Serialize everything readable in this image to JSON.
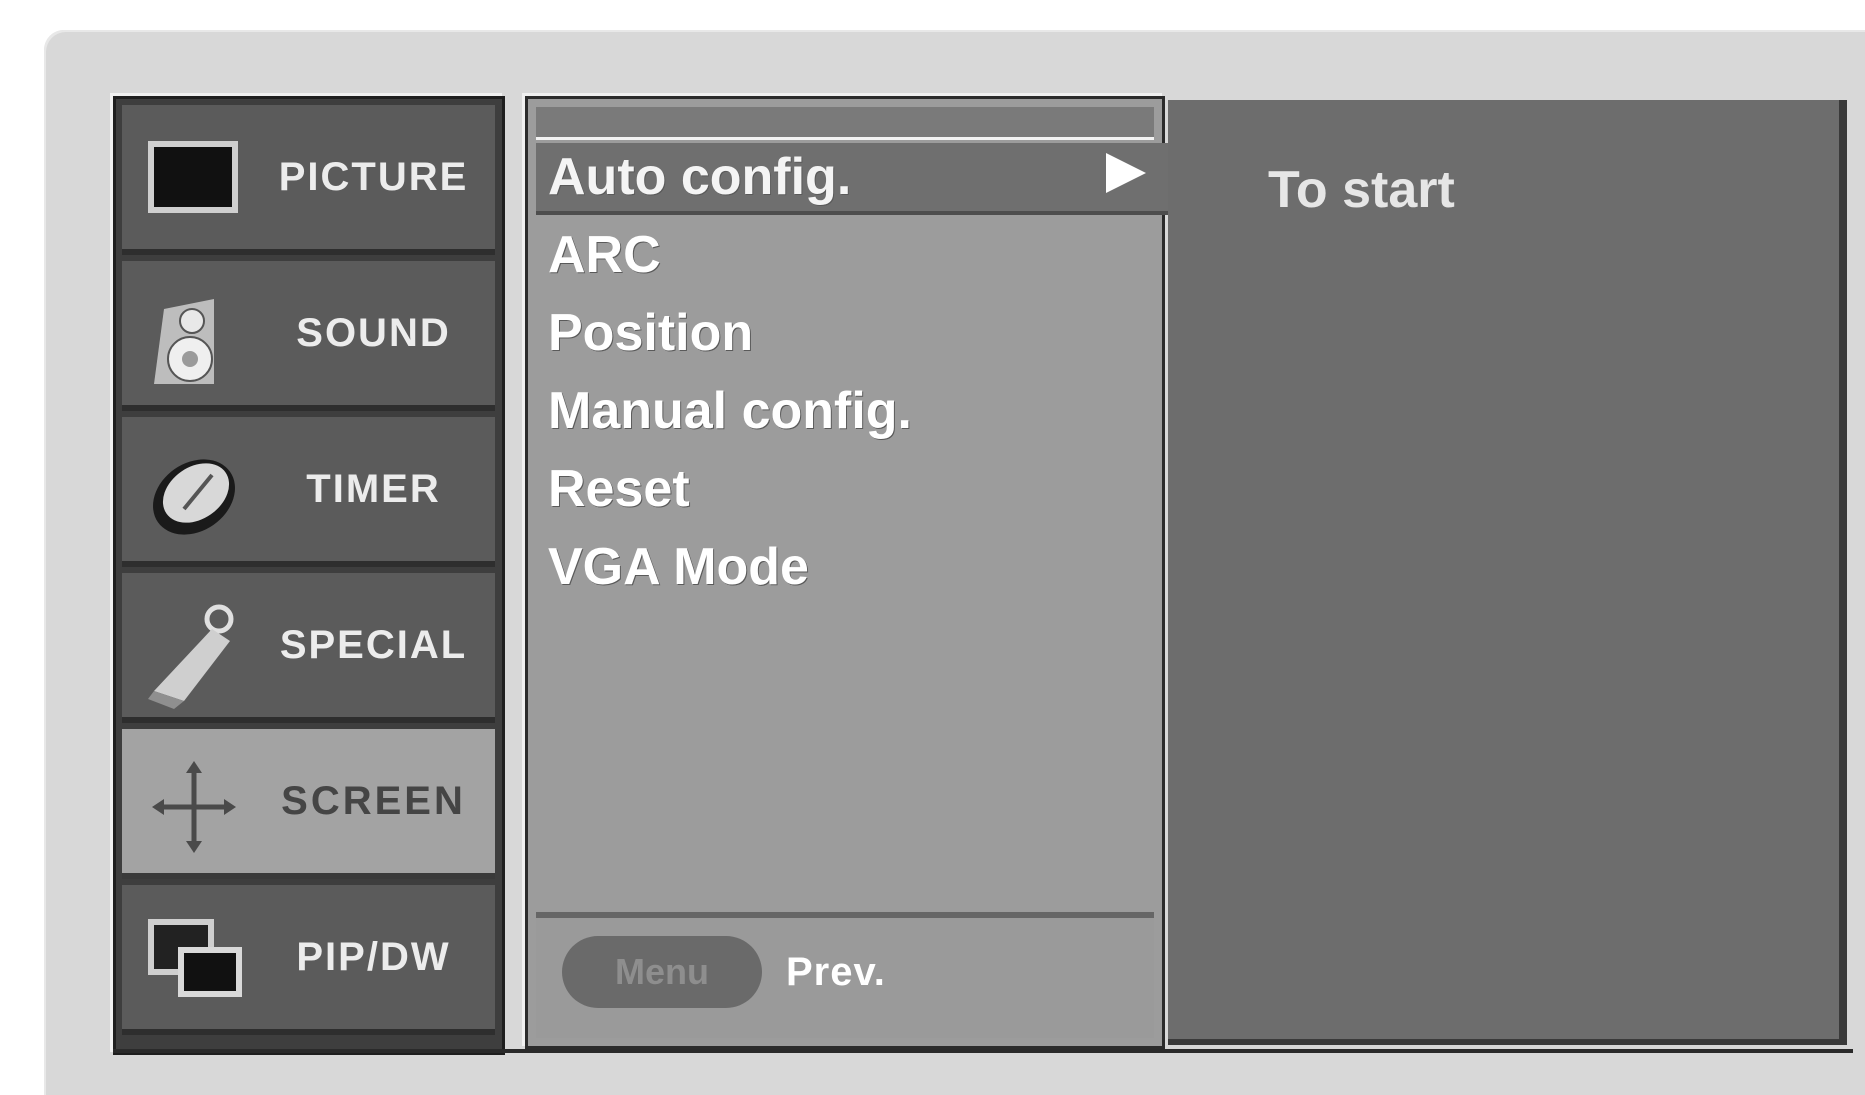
{
  "categories": [
    {
      "label": "PICTURE",
      "icon": "picture-icon",
      "active": false
    },
    {
      "label": "SOUND",
      "icon": "speaker-icon",
      "active": false
    },
    {
      "label": "TIMER",
      "icon": "clock-icon",
      "active": false
    },
    {
      "label": "SPECIAL",
      "icon": "key-tag-icon",
      "active": false
    },
    {
      "label": "SCREEN",
      "icon": "screen-adjust-icon",
      "active": true
    },
    {
      "label": "PIP/DW",
      "icon": "pip-icon",
      "active": false
    }
  ],
  "items": [
    {
      "label": "Auto config.",
      "selected": true
    },
    {
      "label": "ARC",
      "selected": false
    },
    {
      "label": "Position",
      "selected": false
    },
    {
      "label": "Manual config.",
      "selected": false
    },
    {
      "label": "Reset",
      "selected": false
    },
    {
      "label": "VGA Mode",
      "selected": false
    }
  ],
  "footer": {
    "menu_button": "Menu",
    "prev_label": "Prev."
  },
  "info": {
    "text": "To start"
  },
  "colors": {
    "panel": "#6d6d6d",
    "list": "#9c9c9c",
    "category": "#5b5b5b",
    "active_category": "#a3a3a3"
  }
}
